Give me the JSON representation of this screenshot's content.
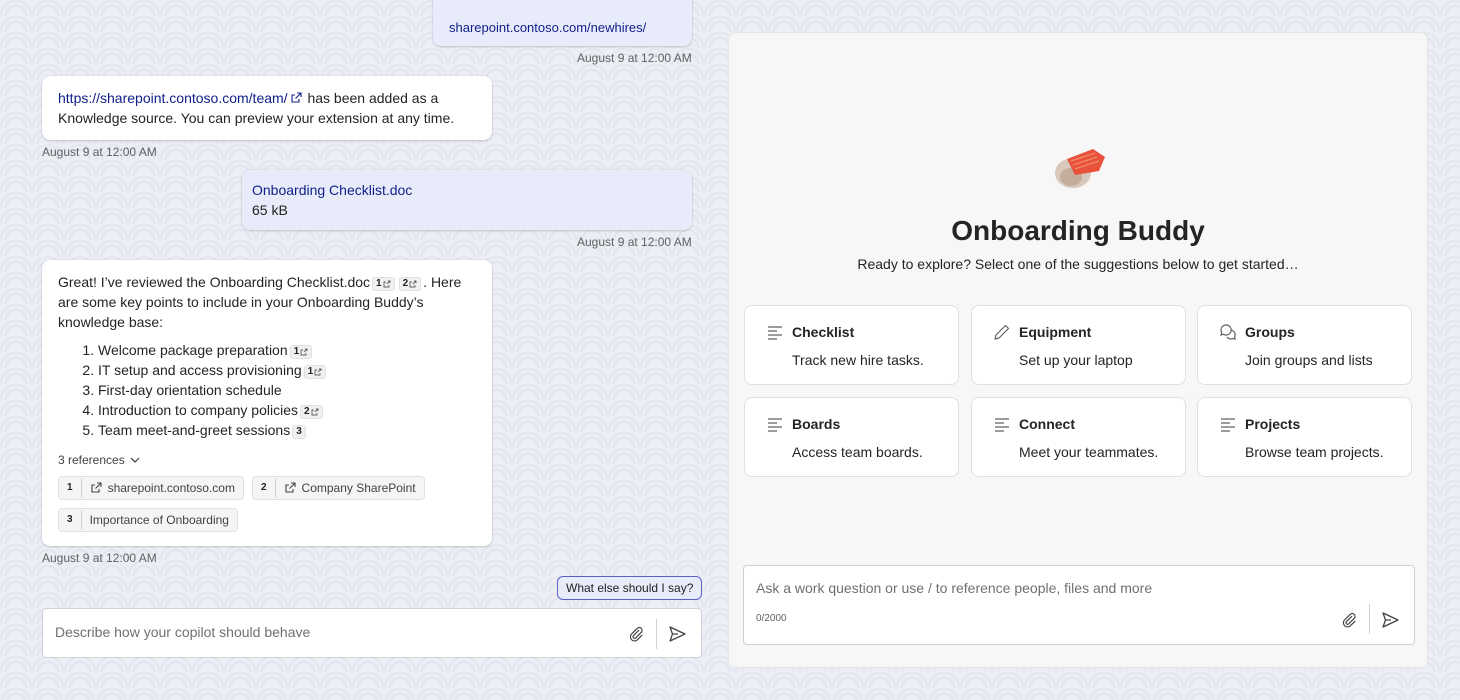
{
  "chat": {
    "top_bubble_text": "sharepoint.contoso.com/newhires/",
    "top_timestamp": "August 9 at 12:00 AM",
    "msg1": {
      "link": "https://sharepoint.contoso.com/team/",
      "text": "has been added as a Knowledge source. You can preview your extension at any time.",
      "timestamp": "August 9 at 12:00 AM"
    },
    "file_msg": {
      "name": "Onboarding Checklist.doc",
      "size": "65 kB",
      "timestamp": "August 9 at 12:00 AM"
    },
    "msg2": {
      "intro_a": "Great! I’ve reviewed the Onboarding Checklist.doc",
      "intro_b": ". Here are some key points to include in your Onboarding Buddy’s knowledge base:",
      "intro_cite1": "1",
      "intro_cite2": "2",
      "points": [
        {
          "text": "Welcome package preparation",
          "cite": "1"
        },
        {
          "text": "IT setup and access provisioning",
          "cite": "1"
        },
        {
          "text": "First-day orientation schedule",
          "cite": ""
        },
        {
          "text": "Introduction to company policies",
          "cite": "2"
        },
        {
          "text": "Team meet-and-greet sessions",
          "cite": "3"
        }
      ],
      "references_label": "3 references",
      "references": [
        {
          "num": "1",
          "label": "sharepoint.contoso.com"
        },
        {
          "num": "2",
          "label": "Company SharePoint"
        },
        {
          "num": "3",
          "label": "Importance of Onboarding"
        }
      ],
      "timestamp": "August 9 at 12:00 AM"
    },
    "suggestion": "What else should I say?",
    "composer_placeholder": "Describe how your copilot should behave"
  },
  "preview": {
    "title": "Onboarding Buddy",
    "subtitle": "Ready to explore? Select one of the suggestions below to get started…",
    "cards": [
      {
        "title": "Checklist",
        "desc": "Track new hire tasks.",
        "icon": "lines-icon"
      },
      {
        "title": "Equipment",
        "desc": "Set up your laptop",
        "icon": "pencil-icon"
      },
      {
        "title": "Groups",
        "desc": "Join groups and lists",
        "icon": "chat-bubbles-icon"
      },
      {
        "title": "Boards",
        "desc": "Access team boards.",
        "icon": "lines-icon"
      },
      {
        "title": "Connect",
        "desc": "Meet your teammates.",
        "icon": "lines-icon"
      },
      {
        "title": "Projects",
        "desc": "Browse team projects.",
        "icon": "lines-icon"
      }
    ],
    "composer_placeholder": "Ask a work question or use / to reference people, files and more",
    "char_count": "0/2000"
  },
  "colors": {
    "accent": "#5b5fc7",
    "link": "#0f1f8a",
    "user_bubble": "#e8ebfa"
  }
}
